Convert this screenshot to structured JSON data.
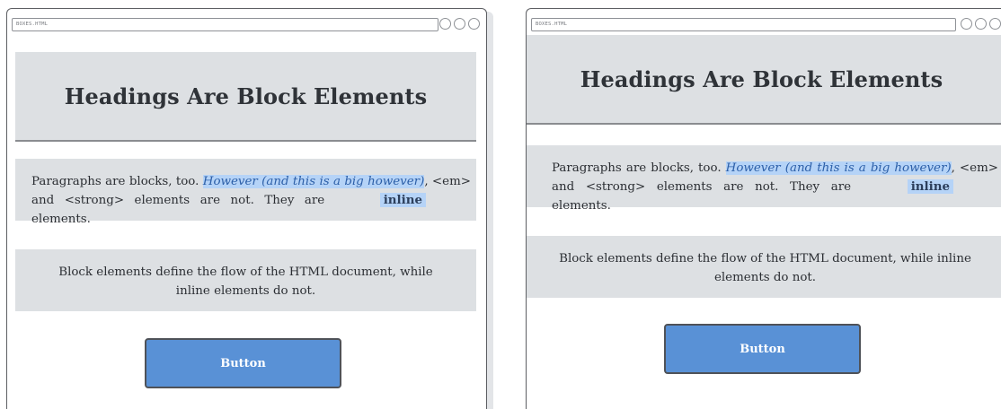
{
  "windows": [
    {
      "url": "BOXES.HTML",
      "heading": "Headings Are Block Elements",
      "paragraph": {
        "prefix": "Paragraphs are blocks, too. ",
        "em_text": "However (and this is a big however)",
        "middle": ", <em> and <strong> elements are not. They are",
        "strong_text": "inline",
        "suffix": "elements."
      },
      "paragraph2": "Block elements define the flow of the HTML document, while inline elements do not.",
      "button_label": "Button"
    },
    {
      "url": "BOXES.HTML",
      "heading": "Headings Are Block Elements",
      "paragraph": {
        "prefix": "Paragraphs are blocks, too. ",
        "em_text": "However (and this is a big however)",
        "middle": ", <em> and <strong> elements are not. They are",
        "strong_text": "inline",
        "suffix": "elements."
      },
      "paragraph2": "Block elements define the flow of the HTML document, while inline elements do not.",
      "button_label": "Button"
    }
  ],
  "colors": {
    "block_bg": "#dde0e3",
    "highlight": "#b5d3f7",
    "button_bg": "#5991d6",
    "border": "#5d5f63"
  }
}
